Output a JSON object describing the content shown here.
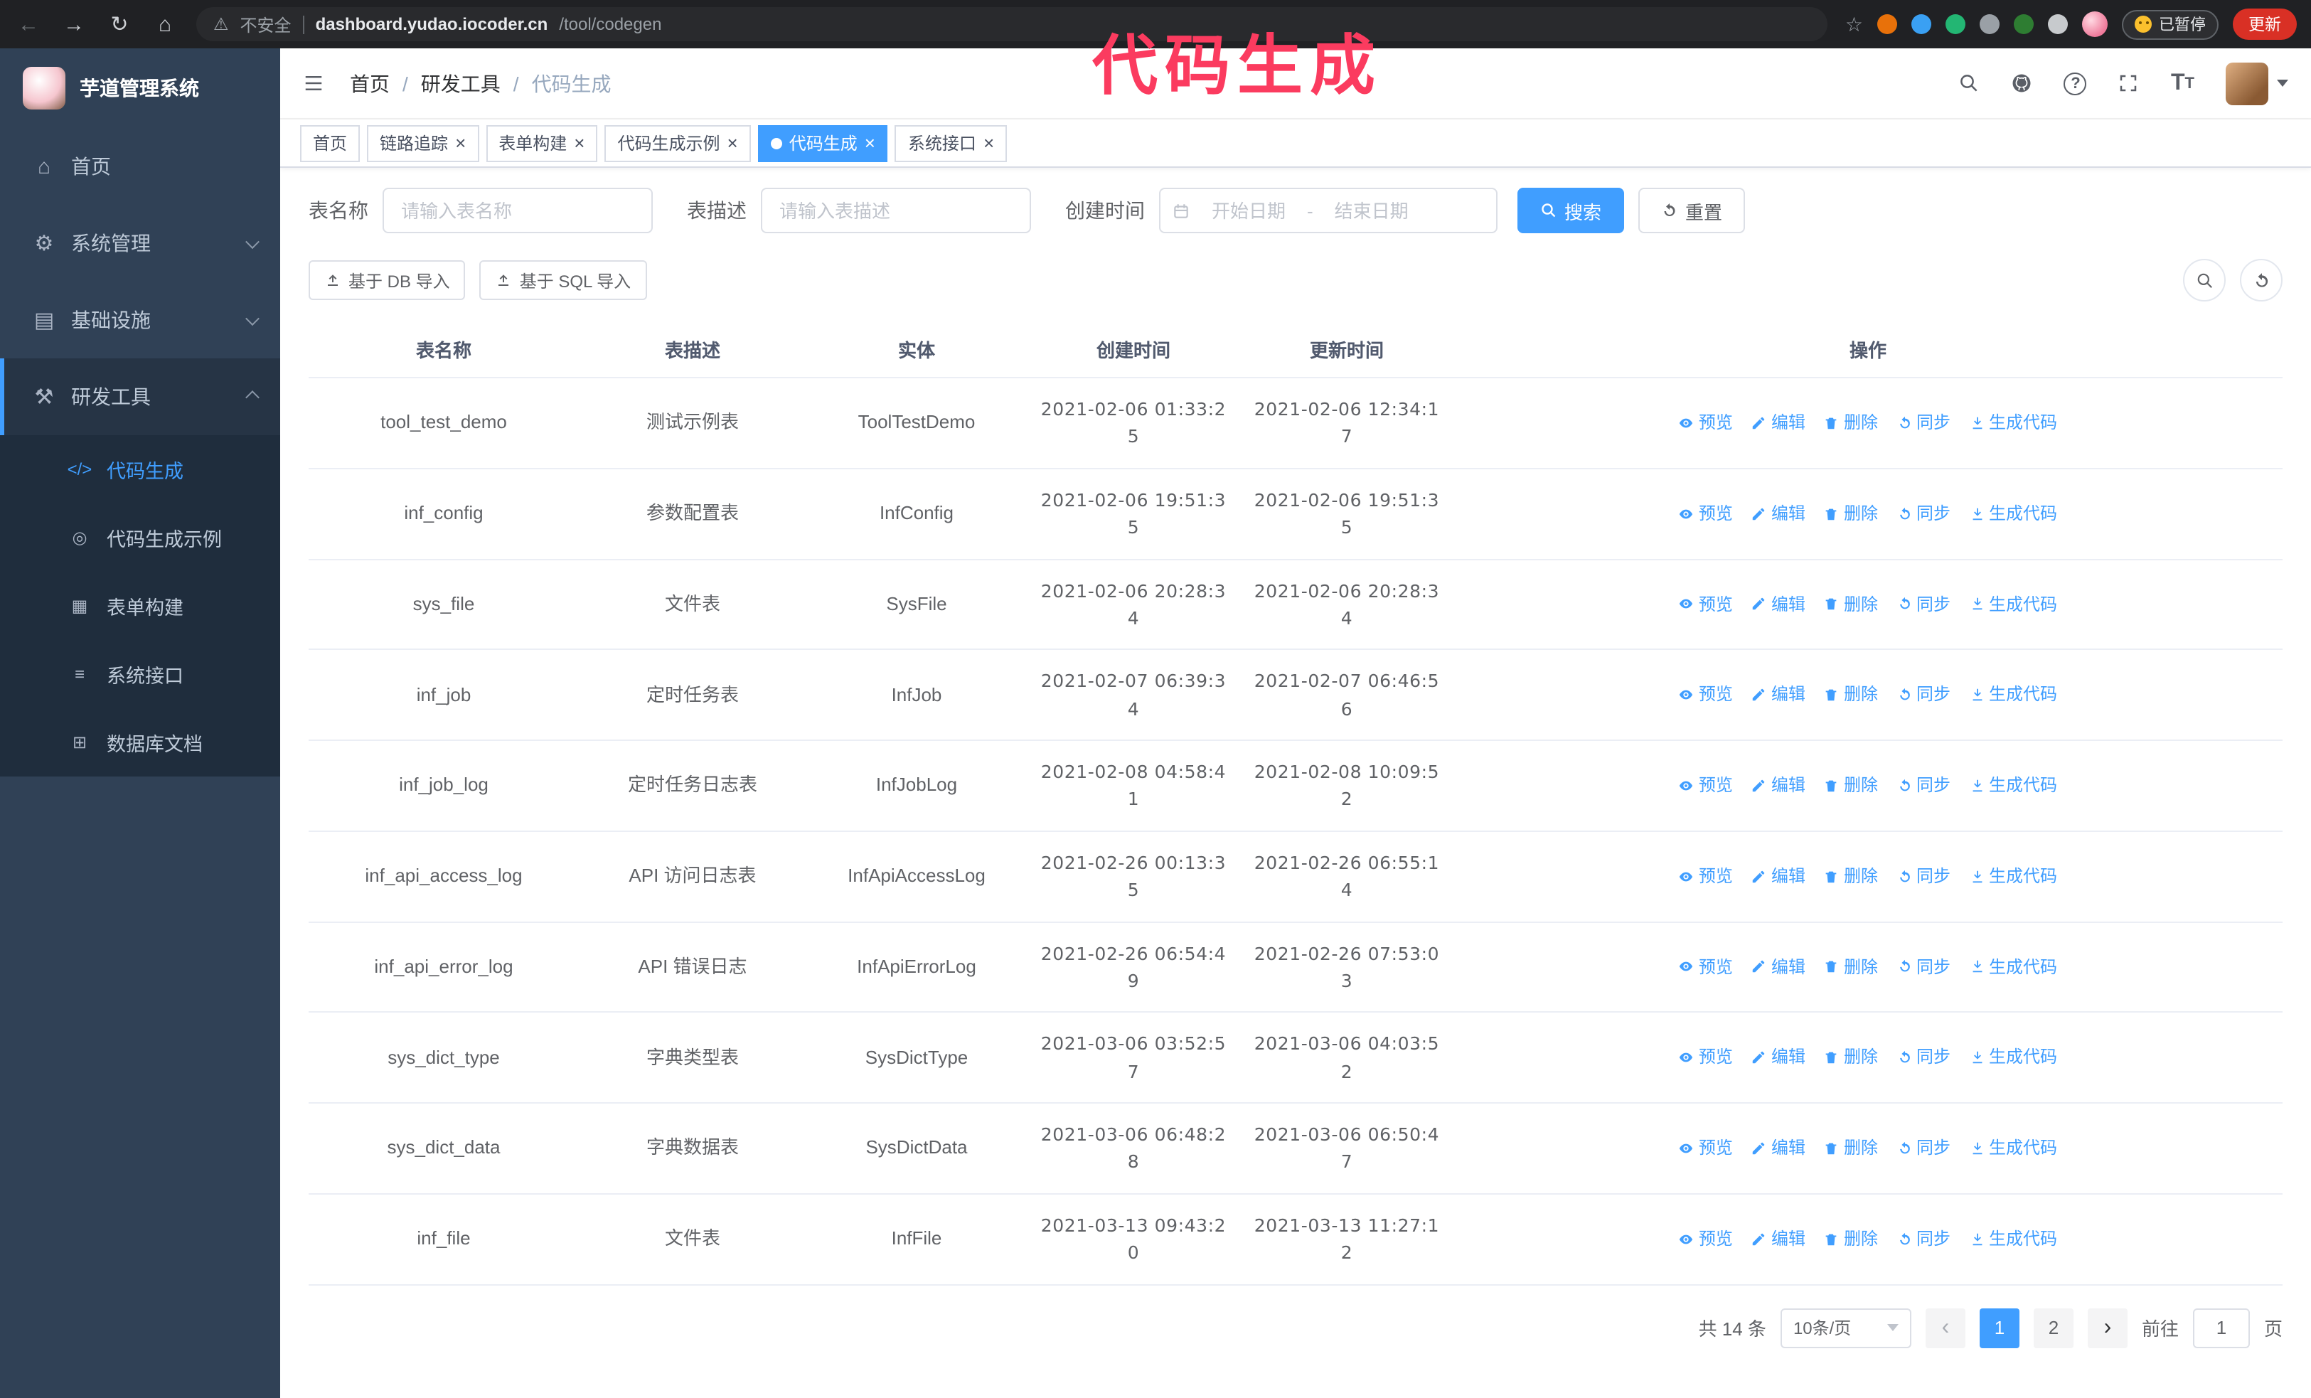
{
  "colors": {
    "accent": "#409eff",
    "sidebar_bg": "#304156",
    "submenu_bg": "#1f2d3d",
    "annotation": "#fb3b5f",
    "update_button_bg": "#d93025"
  },
  "annotation_text": "代码生成",
  "browser": {
    "security_label": "不安全",
    "url_domain": "dashboard.yudao.iocoder.cn",
    "url_path": "/tool/codegen",
    "paused_badge": "已暂停",
    "update_button": "更新",
    "extensions": [
      {
        "name": "extension-1",
        "color": "#e8710a"
      },
      {
        "name": "extension-2",
        "color": "#3aa0f3"
      },
      {
        "name": "extension-3",
        "color": "#23b673"
      },
      {
        "name": "extension-4",
        "color": "#9aa0a6"
      },
      {
        "name": "extension-5",
        "color": "#2e7d32"
      },
      {
        "name": "extension-6",
        "color": "#c7cacd"
      }
    ]
  },
  "icons": {
    "close": "×",
    "slash": "/",
    "home": "⌂",
    "system": "⚙",
    "infra": "▤",
    "tools": "⚒",
    "code": "</>",
    "example": "◎",
    "form": "▦",
    "api": "≡",
    "db": "⊞",
    "back": "←",
    "forward": "→",
    "reload": "↻",
    "warning": "⚠",
    "star": "☆",
    "question": "?",
    "font_t": "T",
    "prev": "‹",
    "next": "›"
  },
  "sidebar": {
    "logo_title": "芋道管理系统",
    "items": [
      {
        "label": "首页"
      },
      {
        "label": "系统管理"
      },
      {
        "label": "基础设施"
      },
      {
        "label": "研发工具"
      }
    ],
    "subitems": [
      {
        "label": "代码生成",
        "active": true
      },
      {
        "label": "代码生成示例"
      },
      {
        "label": "表单构建"
      },
      {
        "label": "系统接口"
      },
      {
        "label": "数据库文档"
      }
    ]
  },
  "header": {
    "breadcrumb": [
      "首页",
      "研发工具",
      "代码生成"
    ]
  },
  "tabs": [
    {
      "label": "首页",
      "closable": false,
      "active": false
    },
    {
      "label": "链路追踪",
      "closable": true,
      "active": false
    },
    {
      "label": "表单构建",
      "closable": true,
      "active": false
    },
    {
      "label": "代码生成示例",
      "closable": true,
      "active": false
    },
    {
      "label": "代码生成",
      "closable": true,
      "active": true
    },
    {
      "label": "系统接口",
      "closable": true,
      "active": false
    }
  ],
  "filters": {
    "table_name_label": "表名称",
    "table_name_placeholder": "请输入表名称",
    "table_desc_label": "表描述",
    "table_desc_placeholder": "请输入表描述",
    "create_time_label": "创建时间",
    "date_start_placeholder": "开始日期",
    "date_separator": "-",
    "date_end_placeholder": "结束日期",
    "search_button": "搜索",
    "reset_button": "重置"
  },
  "toolbar": {
    "import_db": "基于 DB 导入",
    "import_sql": "基于 SQL 导入"
  },
  "table": {
    "columns": [
      "表名称",
      "表描述",
      "实体",
      "创建时间",
      "更新时间",
      "操作"
    ],
    "actions": [
      "预览",
      "编辑",
      "删除",
      "同步",
      "生成代码"
    ],
    "rows": [
      {
        "name": "tool_test_demo",
        "desc": "测试示例表",
        "entity": "ToolTestDemo",
        "created": "2021-02-06 01:33:25",
        "updated": "2021-02-06 12:34:17"
      },
      {
        "name": "inf_config",
        "desc": "参数配置表",
        "entity": "InfConfig",
        "created": "2021-02-06 19:51:35",
        "updated": "2021-02-06 19:51:35"
      },
      {
        "name": "sys_file",
        "desc": "文件表",
        "entity": "SysFile",
        "created": "2021-02-06 20:28:34",
        "updated": "2021-02-06 20:28:34"
      },
      {
        "name": "inf_job",
        "desc": "定时任务表",
        "entity": "InfJob",
        "created": "2021-02-07 06:39:34",
        "updated": "2021-02-07 06:46:56"
      },
      {
        "name": "inf_job_log",
        "desc": "定时任务日志表",
        "entity": "InfJobLog",
        "created": "2021-02-08 04:58:41",
        "updated": "2021-02-08 10:09:52"
      },
      {
        "name": "inf_api_access_log",
        "desc": "API 访问日志表",
        "entity": "InfApiAccessLog",
        "created": "2021-02-26 00:13:35",
        "updated": "2021-02-26 06:55:14"
      },
      {
        "name": "inf_api_error_log",
        "desc": "API 错误日志",
        "entity": "InfApiErrorLog",
        "created": "2021-02-26 06:54:49",
        "updated": "2021-02-26 07:53:03"
      },
      {
        "name": "sys_dict_type",
        "desc": "字典类型表",
        "entity": "SysDictType",
        "created": "2021-03-06 03:52:57",
        "updated": "2021-03-06 04:03:52"
      },
      {
        "name": "sys_dict_data",
        "desc": "字典数据表",
        "entity": "SysDictData",
        "created": "2021-03-06 06:48:28",
        "updated": "2021-03-06 06:50:47"
      },
      {
        "name": "inf_file",
        "desc": "文件表",
        "entity": "InfFile",
        "created": "2021-03-13 09:43:20",
        "updated": "2021-03-13 11:27:12"
      }
    ]
  },
  "pagination": {
    "total": "共 14 条",
    "page_size": "10条/页",
    "pages": [
      "1",
      "2"
    ],
    "active_page": "1",
    "goto_label": "前往",
    "goto_value": "1",
    "unit_label": "页"
  }
}
